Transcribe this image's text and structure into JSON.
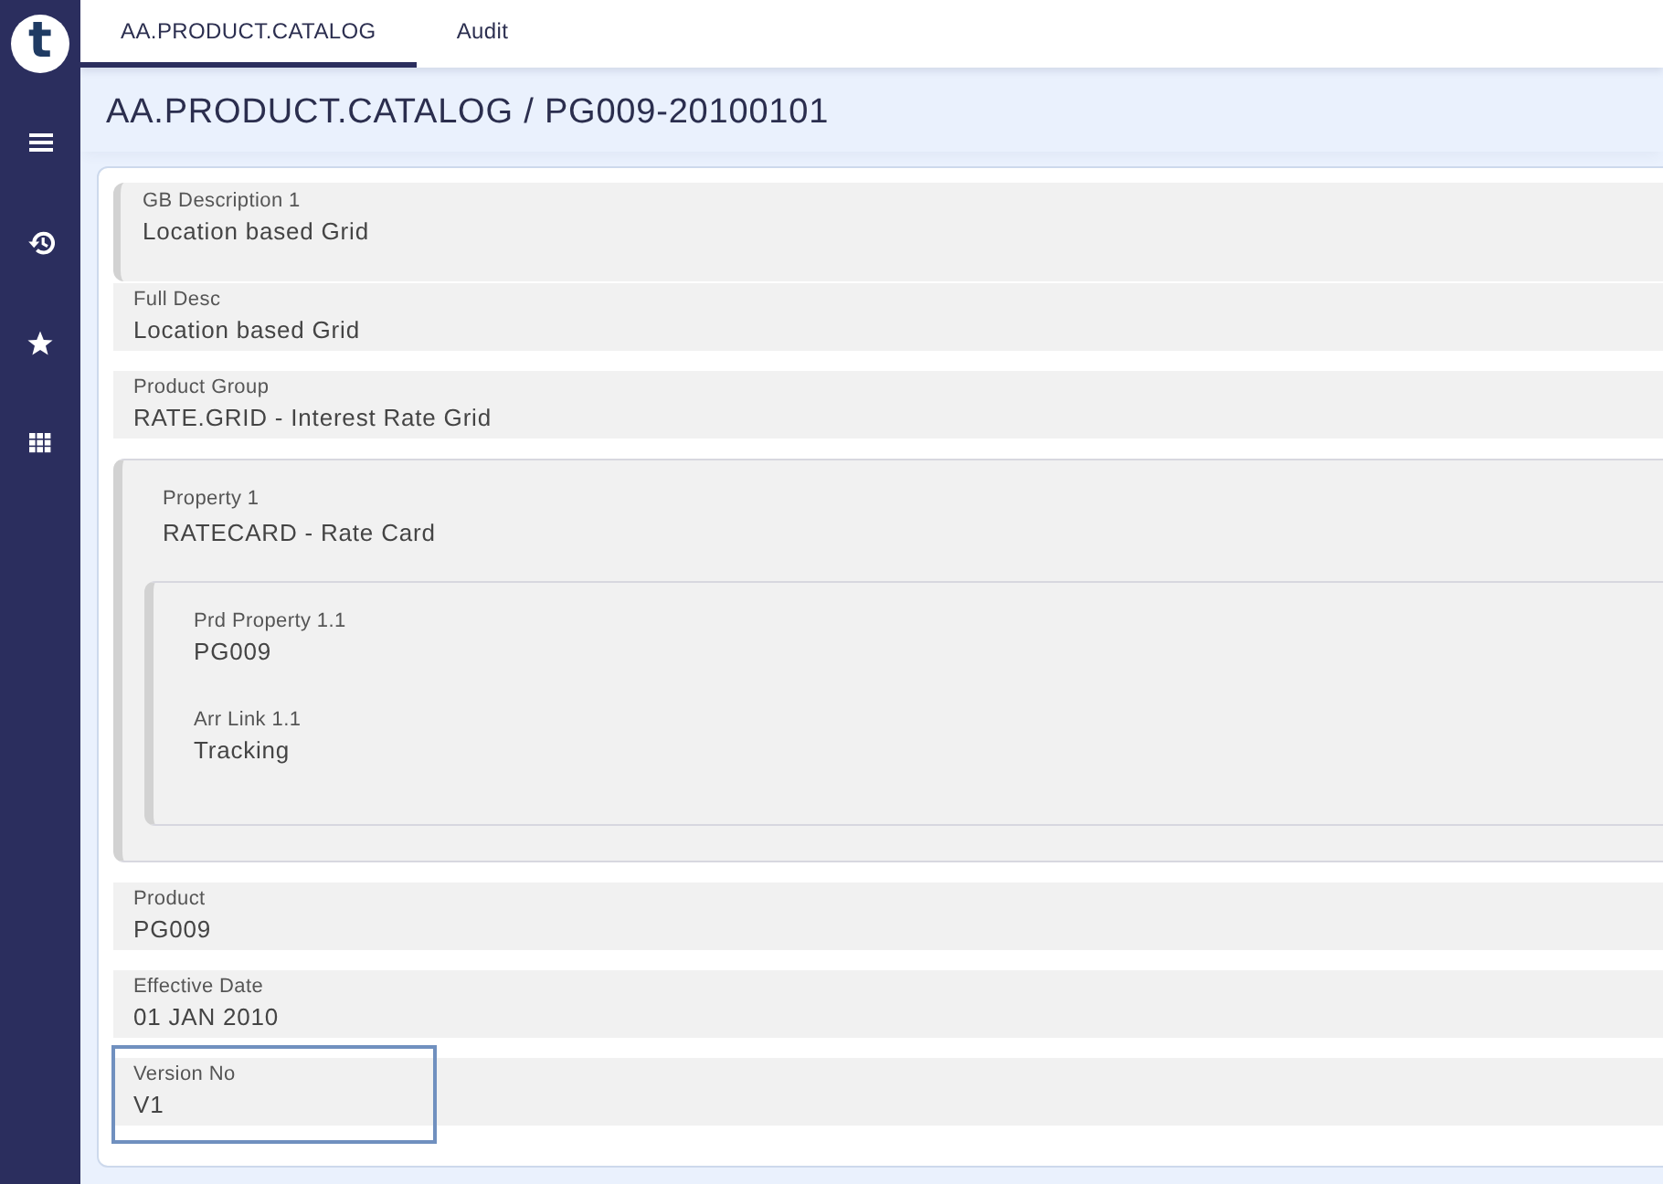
{
  "logo": "t",
  "tabs": [
    {
      "label": "AA.PRODUCT.CATALOG",
      "selected": true
    },
    {
      "label": "Audit",
      "selected": false
    }
  ],
  "title": "AA.PRODUCT.CATALOG / PG009-20100101",
  "fields": [
    {
      "kind": "multi",
      "label": "GB Description 1",
      "value": "Location based Grid",
      "focused": false
    },
    {
      "kind": "field",
      "label": "Full Desc",
      "value": "Location based Grid",
      "focused": false
    },
    {
      "kind": "field",
      "label": "Product Group",
      "value": "RATE.GRID - Interest Rate Grid",
      "focused": false
    },
    {
      "kind": "group",
      "label": "Property 1",
      "value": "RATECARD - Rate Card",
      "focused": false,
      "children": [
        {
          "kind": "group",
          "children": [
            {
              "kind": "field",
              "label": "Prd Property 1.1",
              "value": "PG009"
            },
            {
              "kind": "field",
              "label": "Arr Link 1.1",
              "value": "Tracking"
            }
          ]
        }
      ]
    },
    {
      "kind": "field",
      "label": "Product",
      "value": "PG009",
      "focused": false
    },
    {
      "kind": "field",
      "label": "Effective Date",
      "value": "01 JAN 2010",
      "focused": false
    },
    {
      "kind": "field",
      "label": "Version No",
      "value": "V1",
      "focused": true
    }
  ]
}
